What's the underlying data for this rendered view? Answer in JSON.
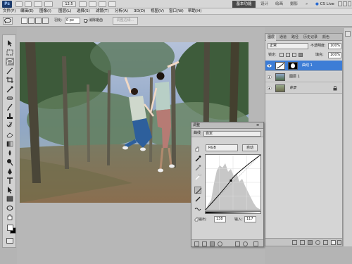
{
  "app": {
    "logo": "Ps",
    "zoom": "12.5",
    "workspaces": [
      "基本功能",
      "设计",
      "绘画",
      "摄影"
    ],
    "cs_live": "CS Live"
  },
  "menu": [
    "文件(F)",
    "编辑(E)",
    "图像(I)",
    "图层(L)",
    "选择(S)",
    "滤镜(T)",
    "分析(A)",
    "3D(D)",
    "视图(V)",
    "窗口(W)",
    "帮助(H)"
  ],
  "options": {
    "feather_label": "羽化:",
    "feather_value": "0 px",
    "antialias_label": "消除锯齿",
    "style_label": "调整边缘..."
  },
  "layers_panel": {
    "tabs": [
      "图层",
      "通道",
      "路径",
      "历史记录",
      "颜色"
    ],
    "blend_mode": "正常",
    "opacity_label": "不透明度:",
    "opacity_value": "100%",
    "lock_label": "锁定:",
    "fill_label": "填充:",
    "fill_value": "100%",
    "layers": [
      {
        "name": "曲线 1",
        "selected": true
      },
      {
        "name": "图层 1",
        "selected": false
      },
      {
        "name": "背景",
        "selected": false
      }
    ]
  },
  "adjustments_panel": {
    "tab": "调整",
    "title": "曲线",
    "preset": "自定",
    "channel": "RGB",
    "auto_label": "自动",
    "output_label": "输出:",
    "output_value": "138",
    "input_label": "输入:",
    "input_value": "117"
  },
  "colors": {
    "selection": "#3d7dd6",
    "photo_sky": "#8fa6c6",
    "photo_ground": "#8a7a5a"
  }
}
